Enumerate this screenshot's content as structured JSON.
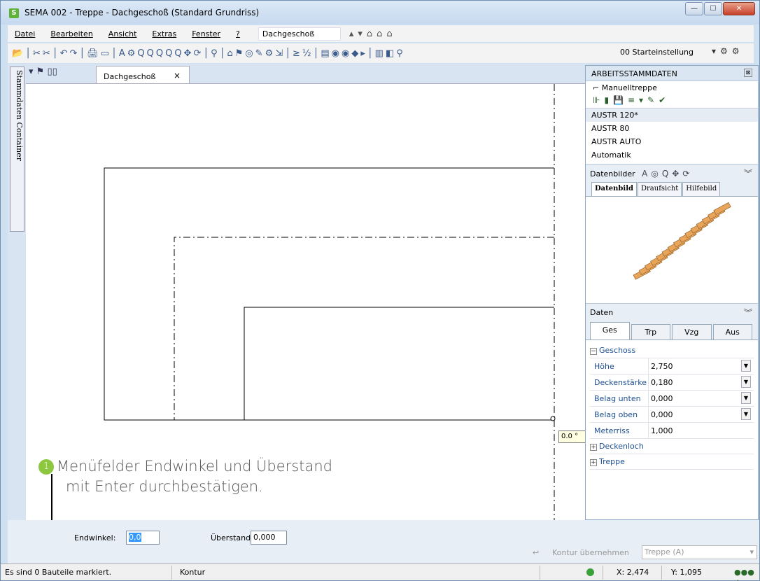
{
  "window": {
    "title": "SEMA  002 - Treppe  - Dachgeschoß (Standard Grundriss)",
    "app_icon": "S"
  },
  "menu": {
    "items": [
      "Datei",
      "Bearbeiten",
      "Ansicht",
      "Extras",
      "Fenster",
      "?"
    ],
    "floor_select": "Dachgeschoß"
  },
  "toolbar": {
    "preset_select": "00 Starteinstellung"
  },
  "left_panel": {
    "tab_label": "Stammdaten Container"
  },
  "document": {
    "tab_label": "Dachgeschoß",
    "tab_close": "×",
    "angle_tooltip": "0.0 °"
  },
  "callout": {
    "number": "1",
    "line1": "Menüfelder Endwinkel und Überstand",
    "line2": "mit Enter durchbestätigen."
  },
  "stammdaten": {
    "header": "ARBEITSSTAMMDATEN",
    "item_title": "Manuelltreppe",
    "list": [
      "AUSTR 120*",
      "AUSTR 80",
      "AUSTR AUTO",
      "Automatik"
    ],
    "selected_index": 0
  },
  "datenbilder": {
    "header": "Datenbilder",
    "tabs": [
      "Datenbild",
      "Draufsicht",
      "Hilfebild"
    ],
    "active_tab": "Datenbild"
  },
  "daten": {
    "header": "Daten",
    "tabs": [
      "Ges",
      "Trp",
      "Vzg",
      "Aus"
    ],
    "group_geschoss": "Geschoss",
    "rows": [
      {
        "key": "Höhe",
        "value": "2,750"
      },
      {
        "key": "Deckenstärke",
        "value": "0,180"
      },
      {
        "key": "Belag unten",
        "value": "0,000"
      },
      {
        "key": "Belag oben",
        "value": "0,000"
      },
      {
        "key": "Meterriss",
        "value": "1,000"
      }
    ],
    "group_deckenloch": "Deckenloch",
    "group_treppe": "Treppe"
  },
  "input_bar": {
    "endwinkel_label": "Endwinkel:",
    "endwinkel_value": "0,0",
    "ueberstand_label": "Überstand:",
    "ueberstand_value": "0,000",
    "kontur_label": "Kontur übernehmen",
    "treppe_select": "Treppe (A)"
  },
  "status": {
    "marked": "Es sind 0 Bauteile markiert.",
    "mode": "Kontur",
    "x": "X: 2,474",
    "y": "Y: 1,095"
  },
  "colors": {
    "accent_green": "#8dc63f",
    "selection_blue": "#3399ff",
    "stair_orange": "#e8a55a"
  }
}
